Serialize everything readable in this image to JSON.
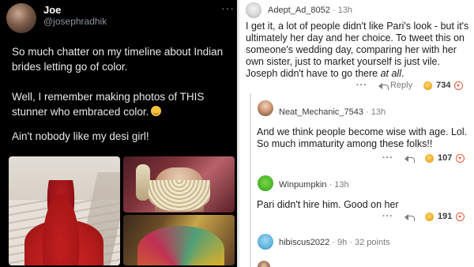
{
  "tweet": {
    "name": "Joe",
    "handle": "@josephradhik",
    "more_label": "···",
    "paragraph1": "So much chatter on my timeline about Indian brides letting go of color.",
    "paragraph2": "Well, I remember making photos of THIS stunner who embraced color.",
    "paragraph2_emoji": "relieved-face-emoji",
    "paragraph3": "Ain't nobody like my desi girl!"
  },
  "reddit": {
    "comments": [
      {
        "user": "Adept_Ad_8052",
        "meta": " · 13h",
        "body_before_italic": "I get it, a lot of people didn't like Pari's look - but it's ultimately her day and her choice. To tweet this on someone's wedding day, comparing her with her own sister, just to market yourself is just vile. Joseph didn't have to go there ",
        "body_italic": "at all",
        "body_after_italic": ".",
        "more": "···",
        "reply_label": "Reply",
        "score": "734"
      },
      {
        "user": "Neat_Mechanic_7543",
        "meta": " · 13h",
        "body": "And we think people become wise with age. Lol. So much immaturity among these folks!!",
        "more": "···",
        "score": "107"
      },
      {
        "user": "Winpumpkin",
        "meta": " · 13h",
        "body": "Pari didn't hire him. Good on her",
        "more": "···",
        "score": "191"
      },
      {
        "user": "hibiscus2022",
        "meta": " · 9h · 32 points"
      }
    ]
  },
  "colors": {
    "tweet_bg": "#000000",
    "tweet_text": "#e7e9ea",
    "tweet_muted": "#8b949a",
    "reddit_bg": "#ffffff",
    "downvote": "#e05a3a",
    "award": "#e8a92a"
  }
}
